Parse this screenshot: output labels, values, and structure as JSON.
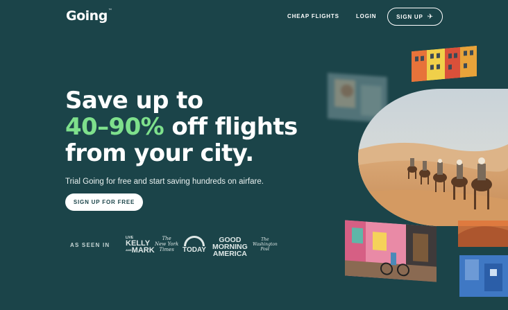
{
  "nav": {
    "logo": "Going",
    "logo_tm": "™",
    "cheap_flights": "CHEAP FLIGHTS",
    "login": "LOGIN",
    "signup": "SIGN UP"
  },
  "hero": {
    "line1": "Save up to",
    "highlight": "40–90%",
    "line2_rest": " off flights",
    "line3": "from your city.",
    "subtitle": "Trial Going for free and start saving hundreds on airfare.",
    "cta": "SIGN UP FOR FREE"
  },
  "press": {
    "label": "AS SEEN IN",
    "kelly_live": "LIVE",
    "kelly_top": "KELLY",
    "kelly_bottom": "MARK",
    "kelly_and": "AND",
    "nyt_1": "The",
    "nyt_2": "New York",
    "nyt_3": "Times",
    "today": "TODAY",
    "gma_1": "GOOD",
    "gma_2": "MORNING",
    "gma_3": "AMERICA",
    "wapo_1": "The",
    "wapo_2": "Washington",
    "wapo_3": "Post"
  },
  "colors": {
    "background": "#1b4449",
    "accent": "#7ee08c",
    "text": "#ffffff"
  }
}
